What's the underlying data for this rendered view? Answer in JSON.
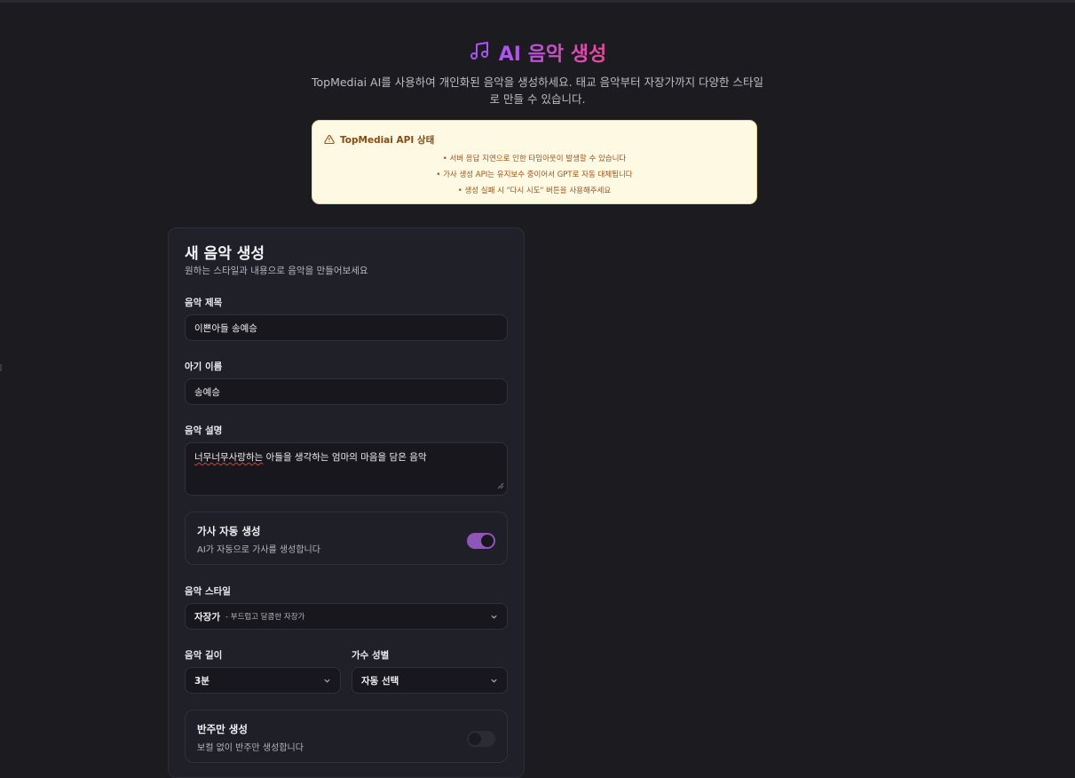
{
  "header": {
    "title": "AI 음악 생성",
    "subtitle": "TopMediai AI를 사용하여 개인화된 음악을 생성하세요. 태교 음악부터 자장가까지 다양한 스타일로 만들 수 있습니다."
  },
  "notice": {
    "title": "TopMediai API 상태",
    "lines": [
      "• 서버 응답 지연으로 인한 타임아웃이 발생할 수 있습니다",
      "• 가사 생성 API는 유지보수 중이어서 GPT로 자동 대체됩니다",
      "• 생성 실패 시 \"다시 시도\" 버튼을 사용해주세요"
    ]
  },
  "form": {
    "title": "새 음악 생성",
    "subtitle": "원하는 스타일과 내용으로 음악을 만들어보세요",
    "music_title": {
      "label": "음악 제목",
      "value": "이쁜아들 송예승"
    },
    "baby_name": {
      "label": "아기 이름",
      "value": "송예승"
    },
    "description": {
      "label": "음악 설명",
      "value_flagged": "너무너무사랑하는",
      "value_rest": " 아들을 생각하는 엄마의 마음을 담은 음악"
    },
    "auto_lyrics": {
      "title": "가사 자동 생성",
      "desc": "AI가 자동으로 가사를 생성합니다",
      "enabled": true
    },
    "style": {
      "label": "음악 스타일",
      "value": "자장가",
      "hint": "- 부드럽고 달콤한 자장가"
    },
    "length": {
      "label": "음악 길이",
      "value": "3분"
    },
    "gender": {
      "label": "가수 성별",
      "value": "자동 선택"
    },
    "instrumental": {
      "title": "반주만 생성",
      "desc": "보컬 없이 반주만 생성합니다",
      "enabled": false
    }
  },
  "colors": {
    "accent": "#a855f7",
    "accent2": "#ec4899",
    "toggle_on": "#8e56b6",
    "notice_bg": "#fef9e3"
  }
}
